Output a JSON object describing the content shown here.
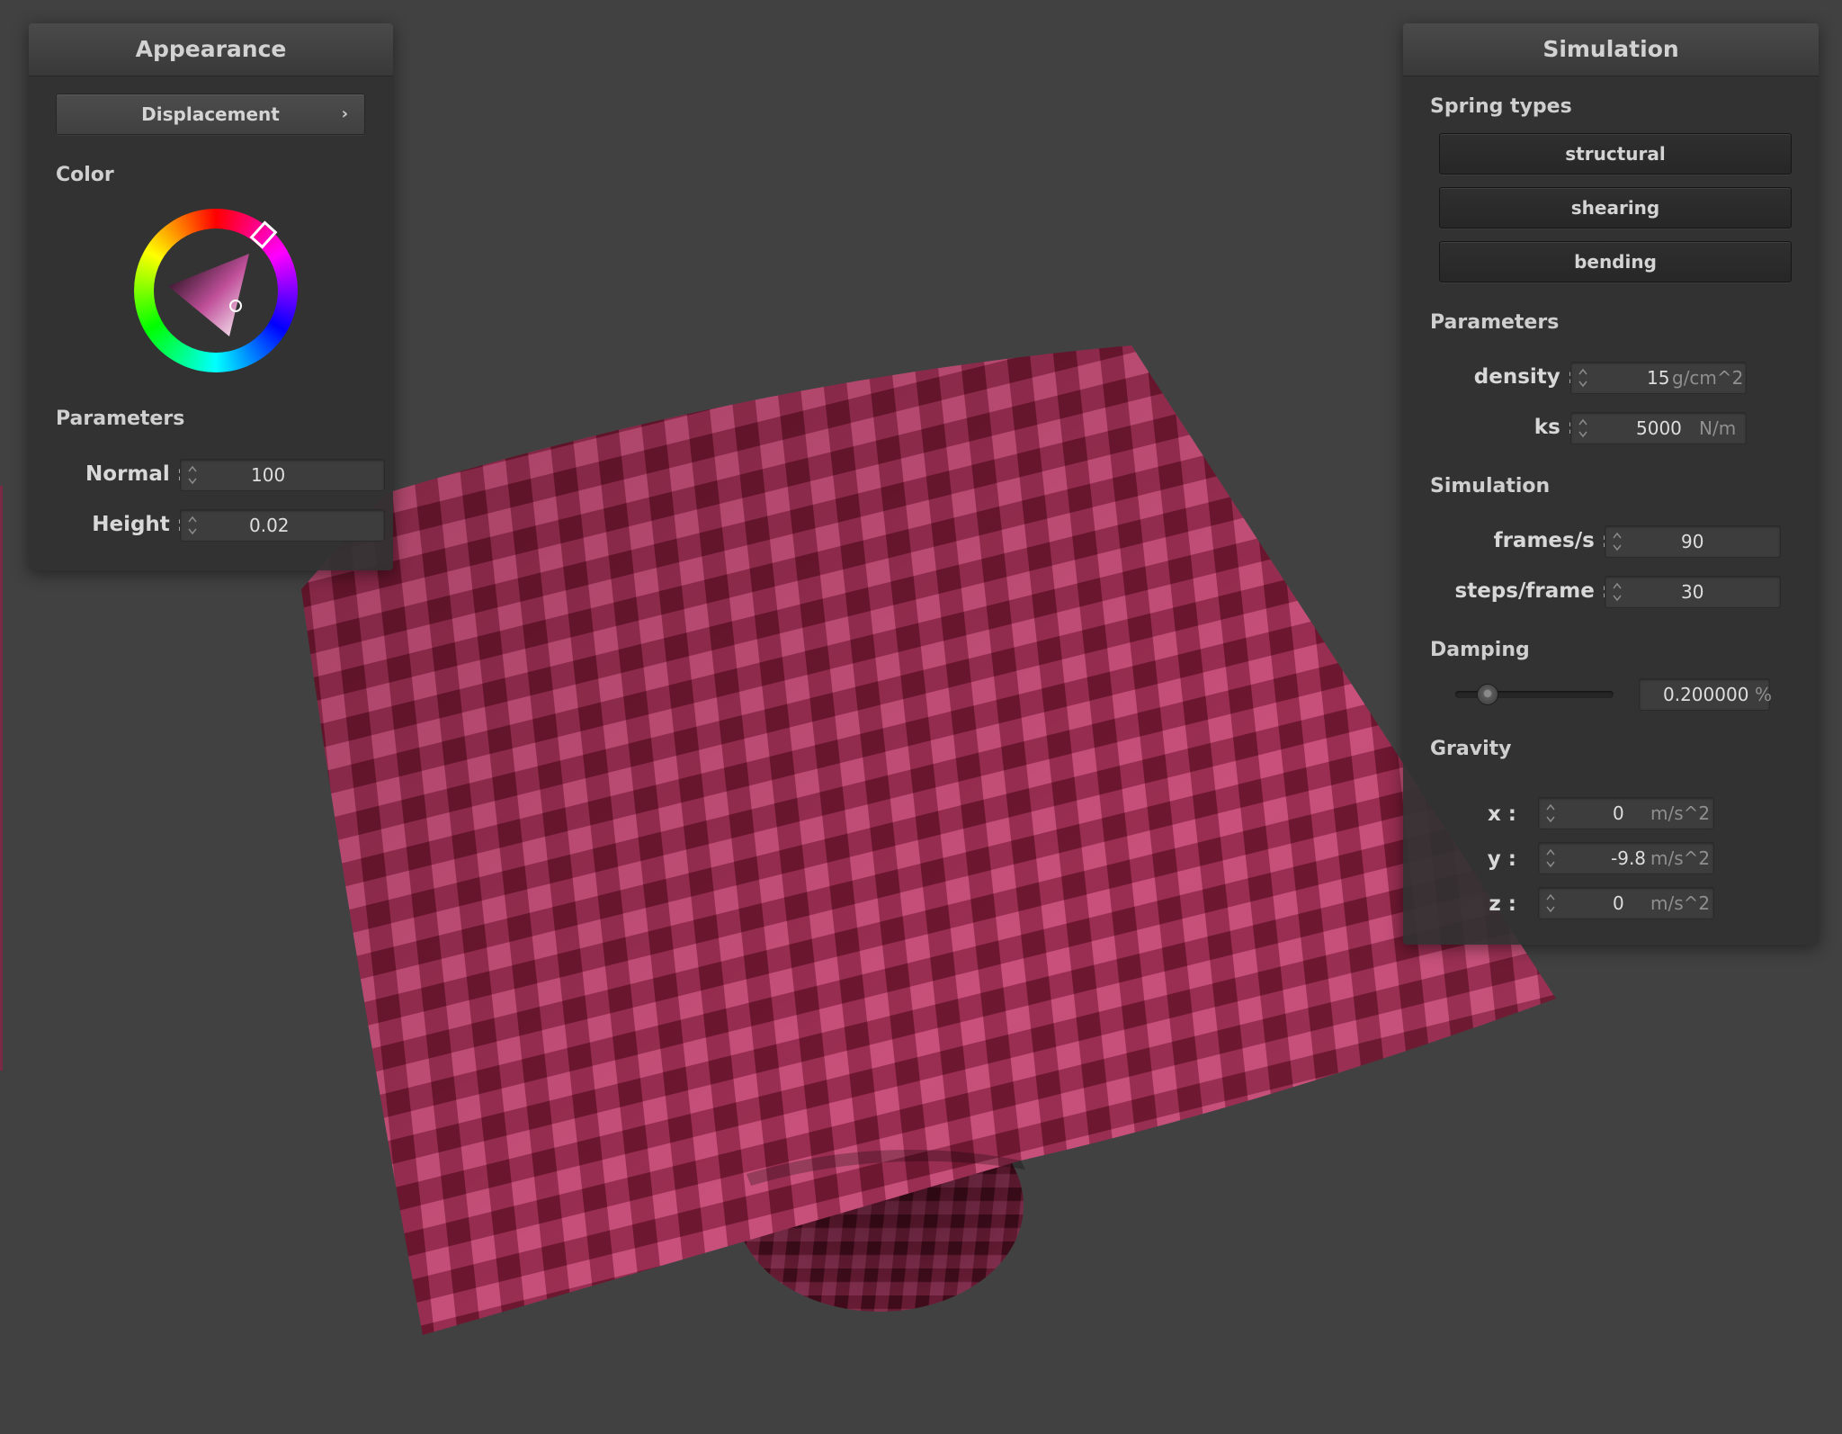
{
  "colors": {
    "background": "#414141",
    "cloth_light": "#c8507a",
    "cloth_dark": "#6e1730",
    "cloth_mid": "#9a2e52",
    "selected_color": "#c0509a"
  },
  "appearance": {
    "title": "Appearance",
    "shader_button": "Displacement",
    "shader_chevron": "›",
    "color_label": "Color",
    "parameters_label": "Parameters",
    "normal_label": "Normal :",
    "normal_value": "100",
    "height_label": "Height :",
    "height_value": "0.02"
  },
  "simulation": {
    "title": "Simulation",
    "spring_types_label": "Spring types",
    "springs": [
      "structural",
      "shearing",
      "bending"
    ],
    "parameters_label": "Parameters",
    "density_label": "density :",
    "density_value": "15",
    "density_unit": "g/cm^2",
    "ks_label": "ks :",
    "ks_value": "5000",
    "ks_unit": "N/m",
    "simulation_label": "Simulation",
    "fps_label": "frames/s :",
    "fps_value": "90",
    "steps_label": "steps/frame :",
    "steps_value": "30",
    "damping_label": "Damping",
    "damping_value": "0.200000",
    "damping_unit": "%",
    "damping_slider_fraction": 0.2,
    "gravity_label": "Gravity",
    "gx_label": "x :",
    "gx_value": "0",
    "gy_label": "y :",
    "gy_value": "-9.8",
    "gz_label": "z :",
    "gz_value": "0",
    "gravity_unit": "m/s^2"
  }
}
